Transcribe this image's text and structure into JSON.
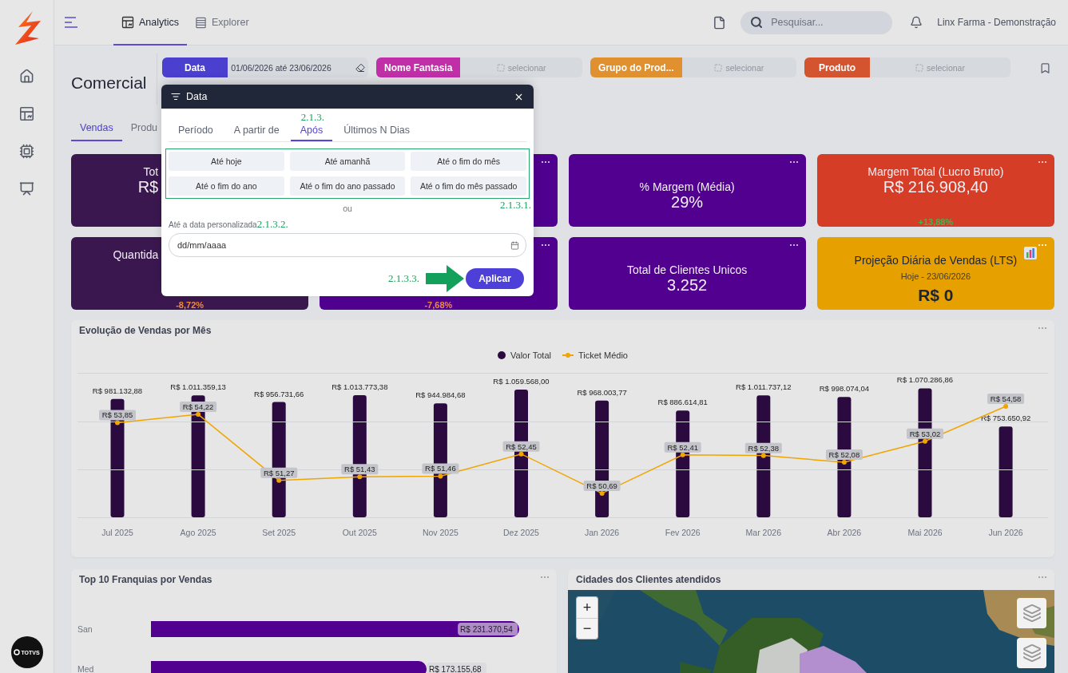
{
  "brand": {
    "footer_logo": "TOTVS"
  },
  "topbar": {
    "tabs": [
      {
        "label": "Analytics",
        "selected": true
      },
      {
        "label": "Explorer",
        "selected": false
      }
    ],
    "search": {
      "placeholder": "Pesquisar..."
    },
    "account": "Linx Farma - Demonstração"
  },
  "page": {
    "title": "Comercial",
    "filters": [
      {
        "label": "Data",
        "value": "01/06/2026 até 23/06/2026",
        "color": "#4a3fcf"
      },
      {
        "label": "Nome Fantasia",
        "placeholder": "selecionar",
        "color": "#c12fa8"
      },
      {
        "label": "Grupo do Prod...",
        "placeholder": "selecionar",
        "color": "#e0902f"
      },
      {
        "label": "Produto",
        "placeholder": "selecionar",
        "color": "#d4542f"
      }
    ],
    "tabs": [
      {
        "label": "Vendas",
        "selected": true
      },
      {
        "label": "Produ",
        "selected": false
      }
    ]
  },
  "kpis": [
    {
      "kind": "covered",
      "color": "#3b1750",
      "title": "Tot",
      "value": "R$"
    },
    {
      "kind": "covered-right",
      "color": "#4f008f"
    },
    {
      "kind": "full",
      "color": "#52008f",
      "title": "% Margem (Média)",
      "value": "29%"
    },
    {
      "kind": "full",
      "color": "#d63d27",
      "title": "Margem Total (Lucro Bruto)",
      "value": "R$ 216.908,40",
      "delta": {
        "text": "+13,88%",
        "color": "#4caf50"
      }
    },
    {
      "kind": "covered",
      "color": "#3b1750",
      "title": "Quantida",
      "delta": {
        "text": "-8,72%",
        "color": "#f08a3a"
      }
    },
    {
      "kind": "covered-right",
      "color": "#4f008f",
      "delta": {
        "text": "-7,68%",
        "color": "#f08a3a"
      }
    },
    {
      "kind": "full",
      "color": "#52008f",
      "title": "Total de Clientes Unicos",
      "value": "3.252"
    },
    {
      "kind": "full",
      "color": "#e6a000",
      "title": "Projeção Diária de Vendas (LTS)",
      "chart_icon": true,
      "subtitle": "Hoje - 23/06/2026",
      "value": "R$ 0"
    }
  ],
  "modal": {
    "title": "Data",
    "tabs": [
      {
        "label": "Período",
        "selected": false
      },
      {
        "label": "A partir de",
        "selected": false
      },
      {
        "label": "Após",
        "selected": true
      },
      {
        "label": "Últimos N Dias",
        "selected": false
      }
    ],
    "presets": [
      "Até hoje",
      "Até amanhã",
      "Até o fim do mês",
      "Até o fim do ano",
      "Até o fim do ano passado",
      "Até o fim do mês passado"
    ],
    "separator": "ou",
    "custom_date": {
      "label": "Até a data personalizada",
      "placeholder": "dd/mm/aaaa"
    },
    "apply_button": "Aplicar",
    "annotations": {
      "tabs": "2.1.3.",
      "presets": "2.1.3.1.",
      "custom_date": "2.1.3.2.",
      "apply": "2.1.3.3."
    }
  },
  "sales_chart": {
    "title": "Evolução de Vendas por Mês",
    "chart_data": {
      "type": "bar",
      "categories": [
        "Jul 2025",
        "Ago 2025",
        "Set 2025",
        "Out 2025",
        "Nov 2025",
        "Dez 2025",
        "Jan 2026",
        "Fev 2026",
        "Mar 2026",
        "Abr 2026",
        "Mai 2026",
        "Jun 2026"
      ],
      "series": [
        {
          "name": "Valor Total",
          "color": "#2b0b3f",
          "values": [
            981132.88,
            1011359.13,
            956731.66,
            1013773.38,
            944984.68,
            1059568.0,
            968003.77,
            886614.81,
            1011737.12,
            998074.04,
            1070286.86,
            753650.92
          ],
          "value_labels": [
            "R$ 981.132,88",
            "R$ 1.011.359,13",
            "R$ 956.731,66",
            "R$ 1.013.773,38",
            "R$ 944.984,68",
            "R$ 1.059.568,00",
            "R$ 968.003,77",
            "R$ 886.614,81",
            "R$ 1.011.737,12",
            "R$ 998.074,04",
            "R$ 1.070.286,86",
            "R$ 753.650,92"
          ]
        }
      ]
    }
  },
  "ticket_chart": {
    "chart_data": {
      "type": "line",
      "series": [
        {
          "name": "Ticket Médio",
          "marker": true,
          "color": "#f0a500",
          "values": [
            53.85,
            54.22,
            51.27,
            51.43,
            51.46,
            52.45,
            50.69,
            52.41,
            52.38,
            52.08,
            53.02,
            54.58
          ],
          "value_labels": [
            "R$ 53,85",
            "R$ 54,22",
            "R$ 51,27",
            "R$ 51,43",
            "R$ 51,46",
            "R$ 52,45",
            "R$ 50,69",
            "R$ 52,41",
            "R$ 52,38",
            "R$ 52,08",
            "R$ 53,02",
            "R$ 54,58"
          ]
        }
      ]
    }
  },
  "franchise_chart": {
    "title": "Top 10 Franquias por Vendas",
    "chart_data": {
      "type": "bar",
      "orientation": "horizontal",
      "categories": [
        "San",
        "Med"
      ],
      "values": [
        231370.54,
        173155.68
      ],
      "value_labels": [
        "R$ 231.370,54",
        "R$ 173.155,68"
      ]
    }
  },
  "map_panel": {
    "title": "Cidades dos Clientes atendidos",
    "zoom_in": "+",
    "zoom_out": "−"
  }
}
